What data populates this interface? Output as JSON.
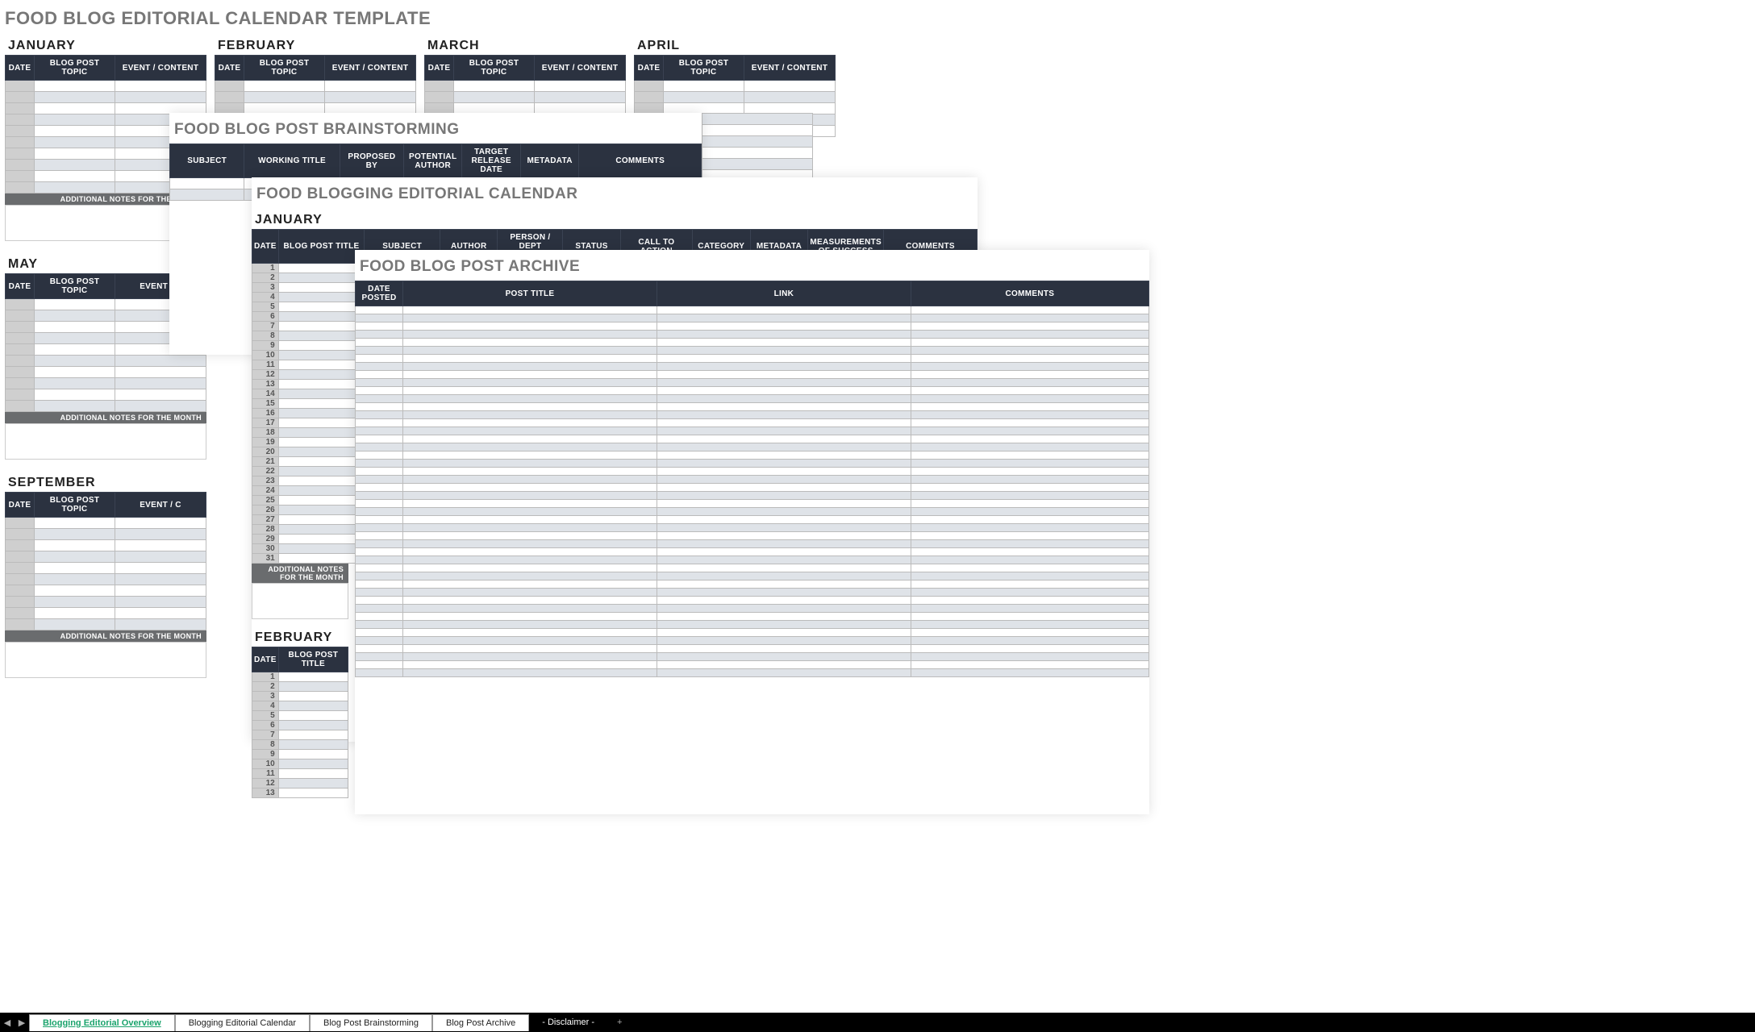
{
  "colors": {
    "header_bg": "#2b3240",
    "alt_row": "#dfe3e8",
    "notes_bar": "#6a6c6e",
    "title_grey": "#777"
  },
  "tabbar": {
    "nav_left": "◀",
    "nav_right": "▶",
    "tabs": [
      {
        "label": "Blogging Editorial Overview",
        "active": true
      },
      {
        "label": "Blogging Editorial Calendar",
        "active": false
      },
      {
        "label": "Blog Post Brainstorming",
        "active": false
      },
      {
        "label": "Blog Post Archive",
        "active": false
      }
    ],
    "disclaimer": "- Disclaimer -",
    "plus": "+"
  },
  "template": {
    "title": "FOOD BLOG EDITORIAL CALENDAR TEMPLATE",
    "months_row1": [
      "JANUARY",
      "FEBRUARY",
      "MARCH",
      "APRIL"
    ],
    "months_row2": [
      "MAY"
    ],
    "months_row3": [
      "SEPTEMBER"
    ],
    "month_cols": [
      "DATE",
      "BLOG POST TOPIC",
      "EVENT / CONTENT"
    ],
    "month_cols_trunc": [
      "DATE",
      "BLOG POST TOPIC",
      "EVENT / C"
    ],
    "notes_label": "ADDITIONAL NOTES FOR THE MONTH",
    "row_count": 10
  },
  "brainstorm": {
    "title": "FOOD BLOG POST BRAINSTORMING",
    "cols": [
      "SUBJECT",
      "WORKING TITLE",
      "PROPOSED BY",
      "POTENTIAL AUTHOR",
      "TARGET RELEASE DATE",
      "METADATA",
      "COMMENTS"
    ],
    "row_count": 2
  },
  "editorial": {
    "title": "FOOD BLOGGING EDITORIAL CALENDAR",
    "month1": "JANUARY",
    "month2": "FEBRUARY",
    "cols": [
      "DATE",
      "BLOG POST TITLE",
      "SUBJECT",
      "AUTHOR",
      "PERSON / DEPT RESPONSIBLE",
      "STATUS",
      "CALL TO ACTION",
      "CATEGORY",
      "METADATA",
      "MEASUREMENTS OF SUCCESS",
      "COMMENTS"
    ],
    "cols_short": [
      "DATE",
      "BLOG POST TITLE"
    ],
    "days1": [
      1,
      2,
      3,
      4,
      5,
      6,
      7,
      8,
      9,
      10,
      11,
      12,
      13,
      14,
      15,
      16,
      17,
      18,
      19,
      20,
      21,
      22,
      23,
      24,
      25,
      26,
      27,
      28,
      29,
      30,
      31
    ],
    "days2": [
      1,
      2,
      3,
      4,
      5,
      6,
      7,
      8,
      9,
      10,
      11,
      12,
      13
    ],
    "notes_label": "ADDITIONAL NOTES FOR THE MONTH"
  },
  "archive": {
    "title": "FOOD BLOG POST ARCHIVE",
    "cols": [
      "DATE POSTED",
      "POST TITLE",
      "LINK",
      "COMMENTS"
    ],
    "row_count": 46
  }
}
